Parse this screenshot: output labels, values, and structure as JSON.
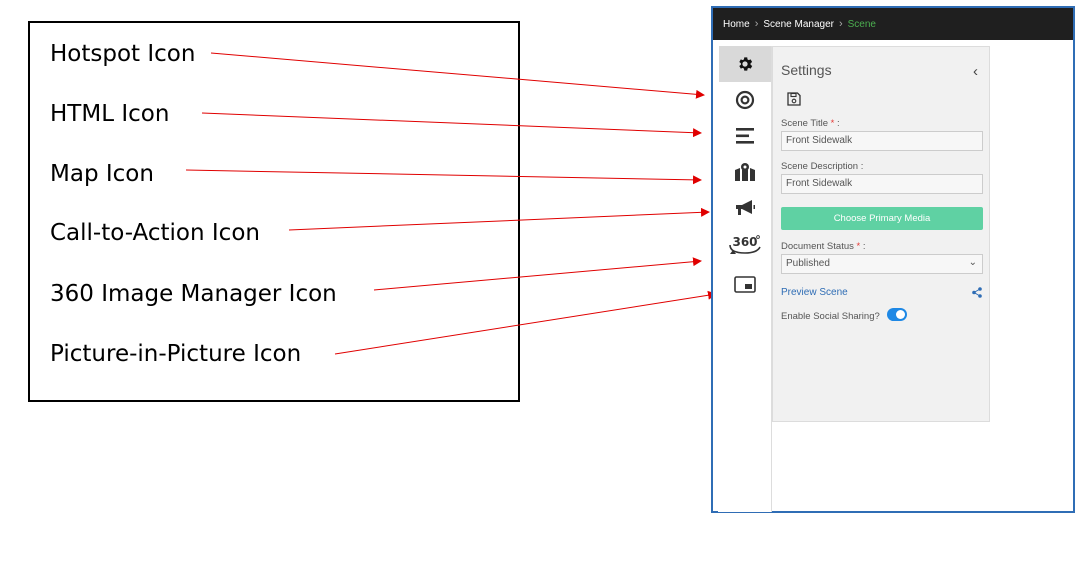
{
  "callout": {
    "labels": [
      "Hotspot Icon",
      "HTML Icon",
      "Map Icon",
      "Call-to-Action Icon",
      "360 Image Manager Icon",
      "Picture-in-Picture Icon"
    ],
    "arrow_color": "#e00000"
  },
  "breadcrumb": {
    "home": "Home",
    "scene_manager": "Scene Manager",
    "current": "Scene"
  },
  "sidebar_icons": [
    {
      "name": "gear-icon",
      "active": true
    },
    {
      "name": "hotspot-icon",
      "active": false
    },
    {
      "name": "html-icon",
      "active": false
    },
    {
      "name": "map-icon",
      "active": false
    },
    {
      "name": "call-to-action-icon",
      "active": false
    },
    {
      "name": "360-image-manager-icon",
      "active": false
    },
    {
      "name": "picture-in-picture-icon",
      "active": false
    }
  ],
  "panel": {
    "title": "Settings",
    "collapse_glyph": "‹",
    "scene_title_label": "Scene Title",
    "scene_title_value": "Front Sidewalk",
    "scene_description_label": "Scene Description :",
    "scene_description_value": "Front Sidewalk",
    "choose_media_label": "Choose Primary Media",
    "document_status_label": "Document Status",
    "document_status_value": "Published",
    "preview_label": "Preview Scene",
    "social_label": "Enable Social Sharing?",
    "social_enabled": true,
    "required_mark": "*",
    "colon": ":"
  },
  "colors": {
    "topbar": "#1f1f1f",
    "breadcrumb_active": "#4caf50",
    "primary_button": "#5fd1a3",
    "link": "#2f6db5",
    "toggle": "#1e88e5",
    "window_border": "#2f6db5"
  }
}
